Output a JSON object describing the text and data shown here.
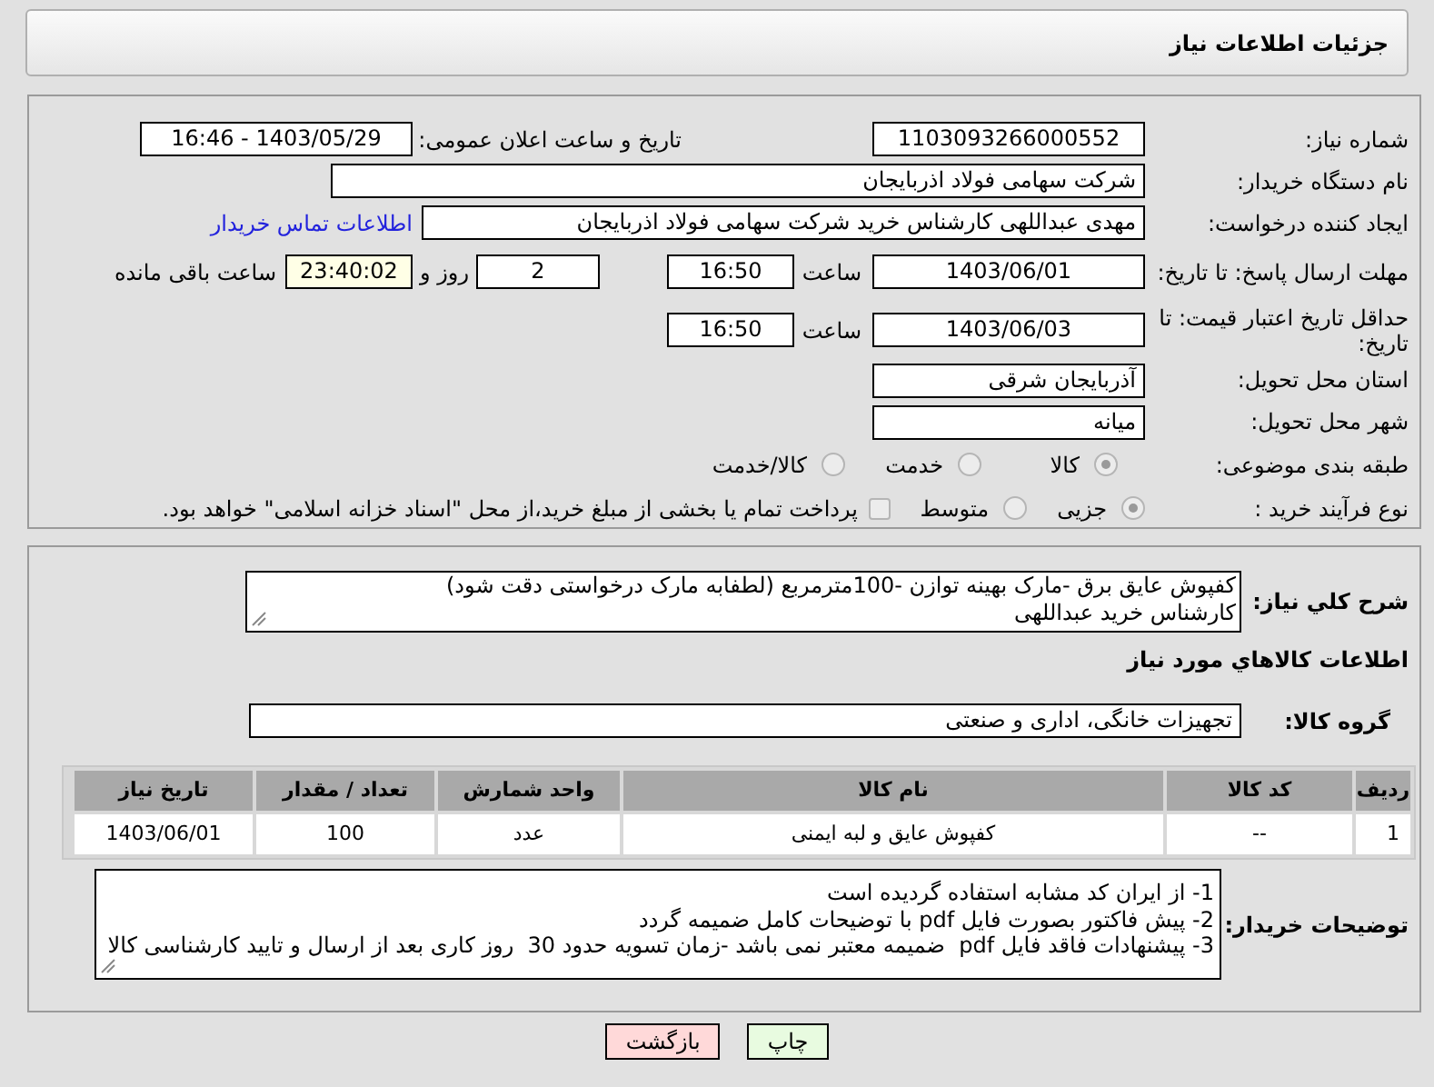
{
  "header": {
    "title": "جزئیات اطلاعات نیاز"
  },
  "need_number": {
    "label": "شماره نیاز:",
    "value": "1103093266000552"
  },
  "announce": {
    "label": "تاریخ و ساعت اعلان عمومی:",
    "value": "1403/05/29 - 16:46"
  },
  "buyer_org": {
    "label": "نام دستگاه خریدار:",
    "value": "شرکت سهامی فولاد اذربایجان"
  },
  "requester": {
    "label": "ایجاد کننده درخواست:",
    "value": "مهدی عبداللهی کارشناس خرید شرکت سهامی فولاد اذربایجان",
    "link": "اطلاعات تماس خریدار"
  },
  "reply_deadline": {
    "label": "مهلت ارسال پاسخ: تا تاریخ:",
    "date": "1403/06/01",
    "time_label": "ساعت",
    "time": "16:50",
    "days": "2",
    "days_label": "روز و",
    "remaining": "23:40:02",
    "remaining_label": "ساعت باقی مانده"
  },
  "price_validity": {
    "label": "حداقل تاریخ اعتبار قیمت: تا تاریخ:",
    "date": "1403/06/03",
    "time_label": "ساعت",
    "time": "16:50"
  },
  "province": {
    "label": "استان محل تحویل:",
    "value": "آذربایجان شرقی"
  },
  "city": {
    "label": "شهر محل تحویل:",
    "value": "میانه"
  },
  "category": {
    "label": "طبقه بندی موضوعی:",
    "options": [
      {
        "label": "کالا",
        "selected": true
      },
      {
        "label": "خدمت",
        "selected": false
      },
      {
        "label": "کالا/خدمت",
        "selected": false
      }
    ]
  },
  "process": {
    "label": "نوع فرآیند خرید :",
    "options": [
      {
        "label": "جزیی",
        "selected": true
      },
      {
        "label": "متوسط",
        "selected": false
      }
    ],
    "payment": {
      "label": "پرداخت تمام یا بخشی از مبلغ خرید،از محل \"اسناد خزانه اسلامی\" خواهد بود.",
      "checked": false
    }
  },
  "description": {
    "label": "شرح کلي نياز:",
    "lines": [
      "کفپوش عایق برق -مارک بهینه توازن -100مترمربع (لطفابه مارک درخواستی دقت شود)",
      "کارشناس خرید عبداللهی"
    ]
  },
  "goods_heading": "اطلاعات کالاهاي مورد نياز",
  "goods_group": {
    "label": "گروه کالا:",
    "value": "تجهیزات خانگی، اداری و صنعتی"
  },
  "table": {
    "columns": [
      "ردیف",
      "کد کالا",
      "نام کالا",
      "واحد شمارش",
      "تعداد / مقدار",
      "تاریخ نیاز"
    ],
    "rows": [
      [
        "1",
        "--",
        "کفپوش عایق و لبه ایمنی",
        "عدد",
        "100",
        "1403/06/01"
      ]
    ]
  },
  "buyer_notes": {
    "label": "توضیحات خریدار:",
    "lines": [
      "1- از ایران کد مشابه استفاده گردیده است",
      "2- پیش فاکتور بصورت فایل pdf با توضیحات کامل ضمیمه گردد",
      "3- پیشنهادات فاقد فایل pdf  ضمیمه معتبر نمی باشد -زمان تسویه حدود 30  روز کاری بعد از ارسال و تایید کارشناسی کالا"
    ]
  },
  "buttons": [
    {
      "label": "چاپ",
      "kind": "print"
    },
    {
      "label": "بازگشت",
      "kind": "back"
    }
  ]
}
